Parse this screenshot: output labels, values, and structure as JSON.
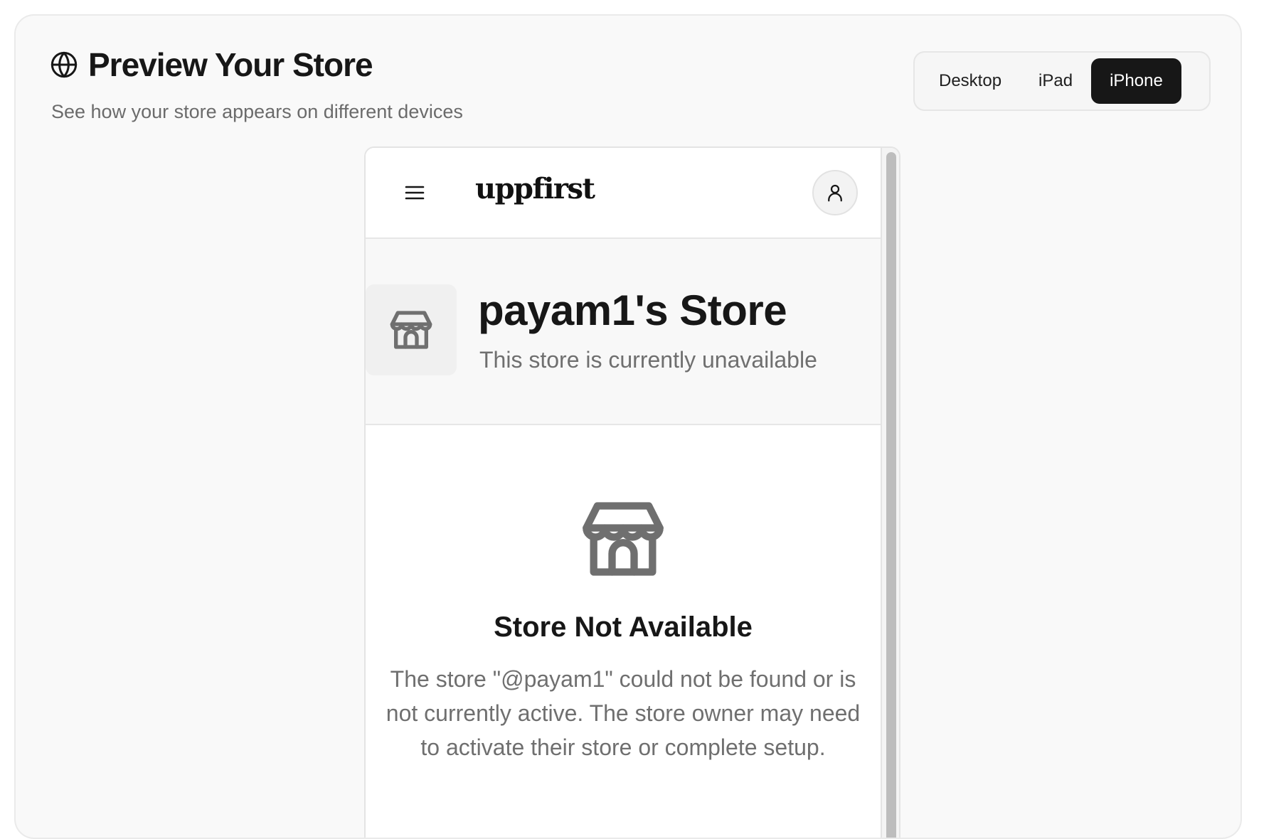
{
  "header": {
    "title": "Preview Your Store",
    "subtitle": "See how your store appears on different devices",
    "icon": "globe-icon"
  },
  "device_switcher": {
    "options": [
      "Desktop",
      "iPad",
      "iPhone"
    ],
    "selected": "iPhone"
  },
  "preview": {
    "navbar": {
      "menu_icon": "hamburger-menu-icon",
      "brand": "uppfirst",
      "account_icon": "user-icon"
    },
    "store": {
      "avatar_icon": "storefront-icon",
      "name": "payam1's Store",
      "status": "This store is currently unavailable"
    },
    "empty_state": {
      "icon": "storefront-icon",
      "title": "Store Not Available",
      "message": "The store \"@payam1\" could not be found or is not currently active. The store owner may need to activate their store or complete setup."
    }
  },
  "colors": {
    "accent": "#171717",
    "muted_text": "#6f6f6f",
    "card_background": "#f9f9f9"
  }
}
